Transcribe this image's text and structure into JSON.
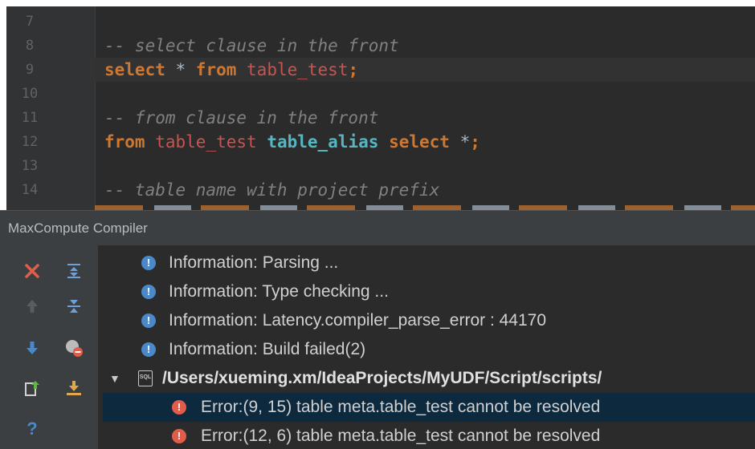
{
  "editor": {
    "lines": [
      {
        "num": "7",
        "tokens": []
      },
      {
        "num": "8",
        "tokens": [
          {
            "t": "-- select clause in the front",
            "c": "cm"
          }
        ]
      },
      {
        "num": "9",
        "current": true,
        "tokens": [
          {
            "t": "select",
            "c": "kw"
          },
          {
            "t": " * ",
            "c": "op"
          },
          {
            "t": "from",
            "c": "kw"
          },
          {
            "t": " ",
            "c": "op"
          },
          {
            "t": "table_test",
            "c": "tbl"
          },
          {
            "t": ";",
            "c": "kw"
          }
        ]
      },
      {
        "num": "10",
        "tokens": []
      },
      {
        "num": "11",
        "tokens": [
          {
            "t": "-- from clause in the front",
            "c": "cm"
          }
        ]
      },
      {
        "num": "12",
        "tokens": [
          {
            "t": "from",
            "c": "kw"
          },
          {
            "t": " ",
            "c": "op"
          },
          {
            "t": "table_test",
            "c": "tbl"
          },
          {
            "t": " ",
            "c": "op"
          },
          {
            "t": "table_alias",
            "c": "alias"
          },
          {
            "t": " ",
            "c": "op"
          },
          {
            "t": "select",
            "c": "kw"
          },
          {
            "t": " *",
            "c": "op"
          },
          {
            "t": ";",
            "c": "kw"
          }
        ]
      },
      {
        "num": "13",
        "tokens": []
      },
      {
        "num": "14",
        "tokens": [
          {
            "t": "-- table name with project prefix",
            "c": "cm"
          }
        ]
      }
    ]
  },
  "tool_window": {
    "title": "MaxCompute Compiler",
    "toolbar": [
      {
        "name": "close-icon",
        "color": "#e05d4b"
      },
      {
        "name": "expand-all-icon",
        "color": "#6e9fd8"
      },
      {
        "name": "arrow-up-icon",
        "color": "#5a5d5f"
      },
      {
        "name": "collapse-all-icon",
        "color": "#6e9fd8"
      },
      {
        "name": "arrow-down-icon",
        "color": "#4a88c7"
      },
      {
        "name": "hide-warnings-icon",
        "color": "#e05d4b"
      },
      {
        "name": "export-icon",
        "color": "#62b543"
      },
      {
        "name": "download-icon",
        "color": "#e0a84b"
      },
      {
        "name": "help-icon",
        "color": "#4a88c7"
      }
    ],
    "messages": [
      {
        "kind": "info",
        "text": "Information: Parsing ..."
      },
      {
        "kind": "info",
        "text": "Information: Type checking ..."
      },
      {
        "kind": "info",
        "text": "Information: Latency.compiler_parse_error : 44170"
      },
      {
        "kind": "info",
        "text": "Information: Build failed(2)"
      },
      {
        "kind": "file",
        "text": "/Users/xueming.xm/IdeaProjects/MyUDF/Script/scripts/",
        "icon_label": "SQL"
      },
      {
        "kind": "error",
        "text": "Error:(9, 15)  table meta.table_test cannot be resolved",
        "selected": true
      },
      {
        "kind": "error",
        "text": "Error:(12, 6)  table meta.table_test cannot be resolved"
      }
    ]
  }
}
